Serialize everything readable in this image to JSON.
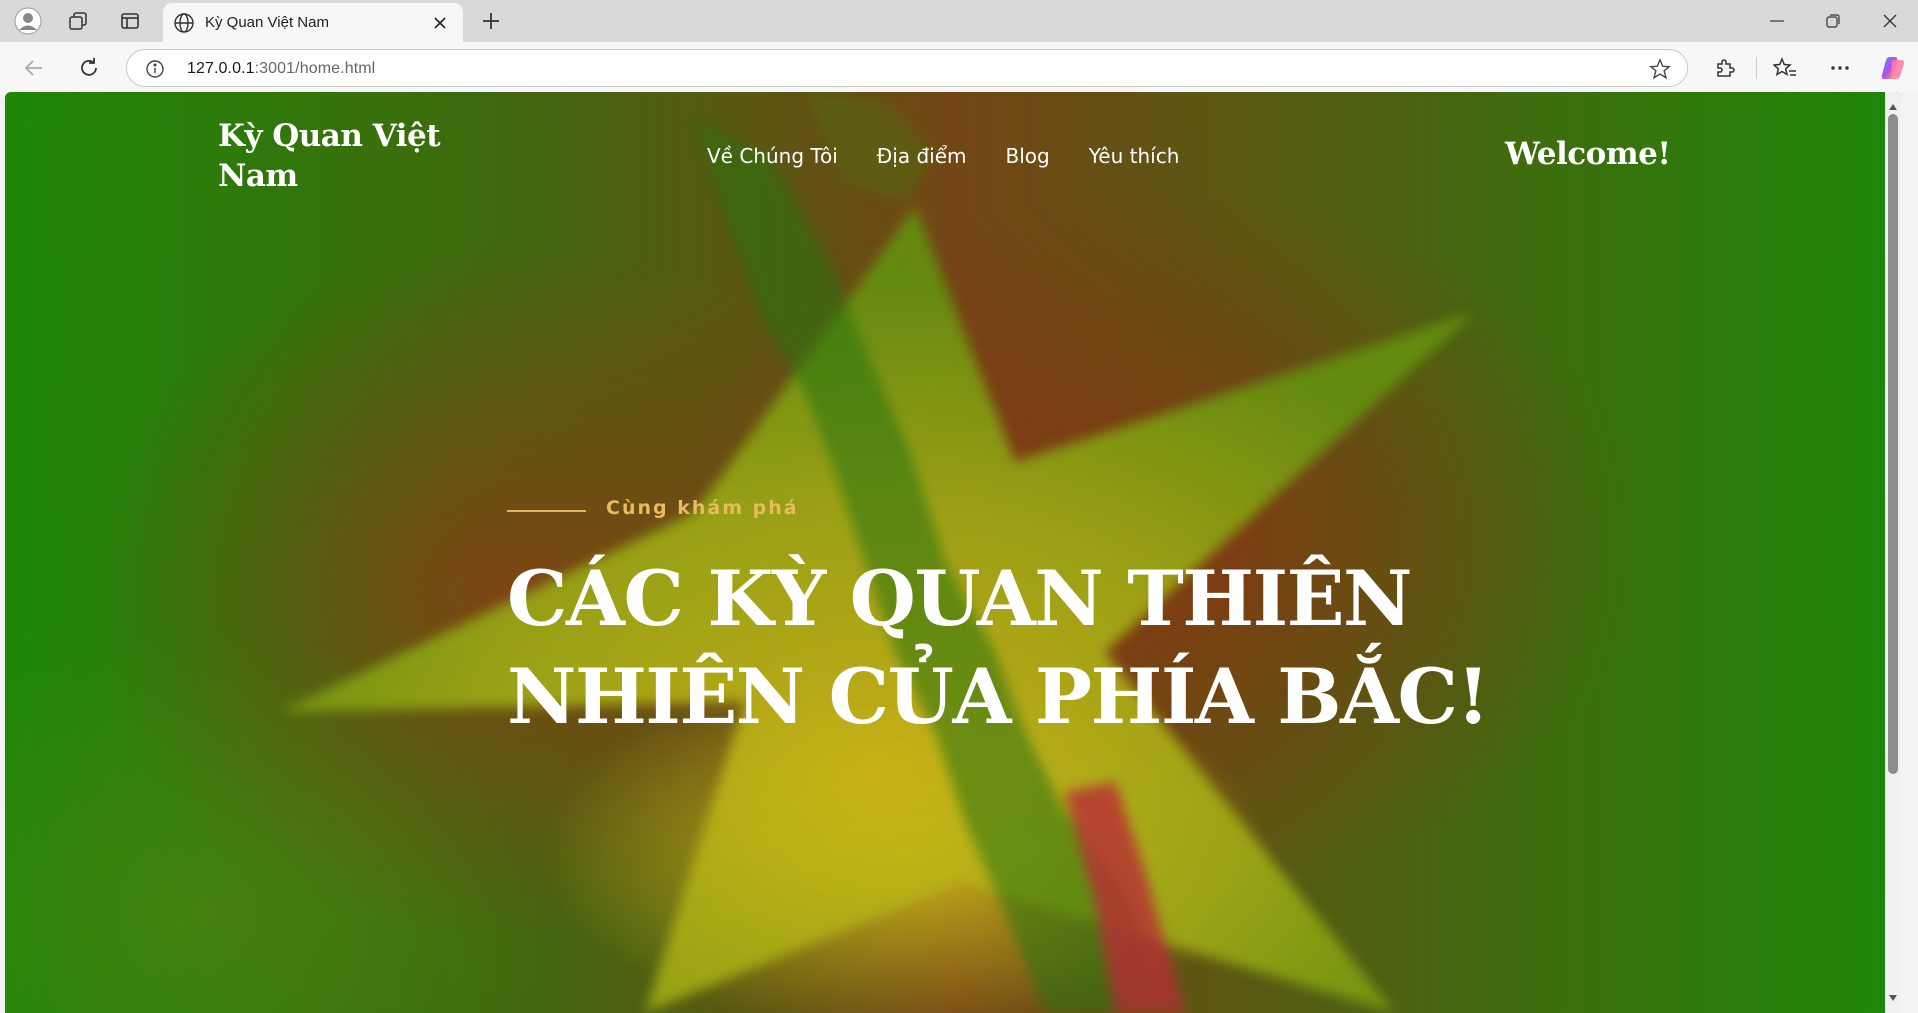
{
  "browser": {
    "tab_title": "Kỳ Quan Việt Nam",
    "url_host": "127.0.0.1",
    "url_path": ":3001/home.html"
  },
  "site": {
    "logo": "Kỳ Quan Việt Nam",
    "nav": [
      "Về Chúng Tôi",
      "Địa điểm",
      "Blog",
      "Yêu thích"
    ],
    "welcome": "Welcome!"
  },
  "hero": {
    "eyebrow": "Cùng khám phá",
    "headline_line1": "CÁC KỲ QUAN THIÊN",
    "headline_line2": "NHIÊN CỦA PHÍA BẮC!"
  },
  "colors": {
    "accent_gold": "#e7bb5e",
    "hero_green": "#1f8f08",
    "hero_red": "#a03418",
    "star_yellow": "#c8d21e"
  },
  "icons": {
    "tab": "globe-icon",
    "profile": "profile-icon",
    "workspaces": "workspaces-icon",
    "tab_actions": "tab-actions-icon",
    "close": "close-icon",
    "new_tab": "plus-icon",
    "back": "back-arrow-icon",
    "reload": "reload-icon",
    "info": "info-icon",
    "favorite": "star-icon",
    "extensions": "puzzle-icon",
    "favorites": "favorites-icon",
    "more": "more-icon",
    "copilot": "copilot-icon"
  }
}
